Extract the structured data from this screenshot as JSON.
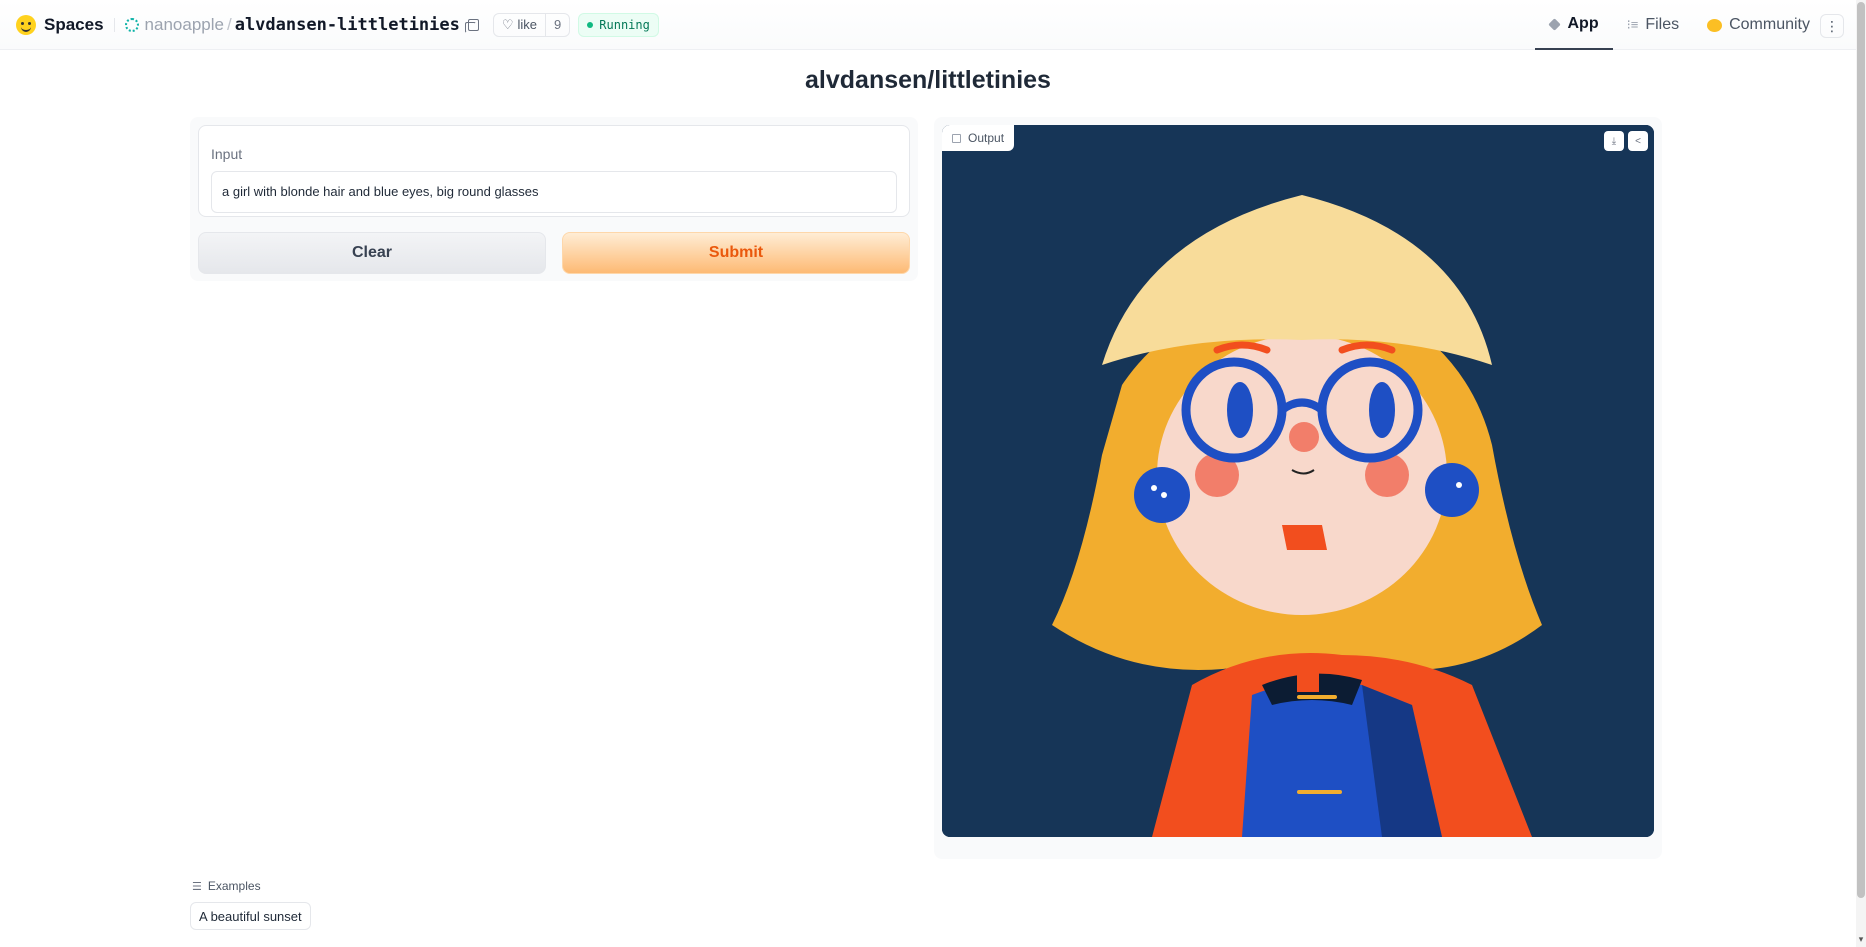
{
  "header": {
    "brand": "Spaces",
    "org": "nanoapple",
    "separator": "/",
    "repo": "alvdansen-littletinies",
    "like_label": "like",
    "like_count": "9",
    "status": "Running",
    "status_color": "#10b981",
    "tabs": [
      {
        "label": "App",
        "icon": "cube-icon",
        "active": true
      },
      {
        "label": "Files",
        "icon": "files-icon",
        "active": false
      },
      {
        "label": "Community",
        "icon": "community-icon",
        "active": false
      }
    ],
    "menu_icon": "more-vertical-icon"
  },
  "app": {
    "title": "alvdansen/littletinies",
    "input_label": "Input",
    "input_value": "a girl with blonde hair and blue eyes, big round glasses",
    "clear_label": "Clear",
    "submit_label": "Submit",
    "submit_color": "#ea580c",
    "output_label": "Output"
  },
  "examples": {
    "label": "Examples",
    "items": [
      "A beautiful sunset"
    ]
  }
}
